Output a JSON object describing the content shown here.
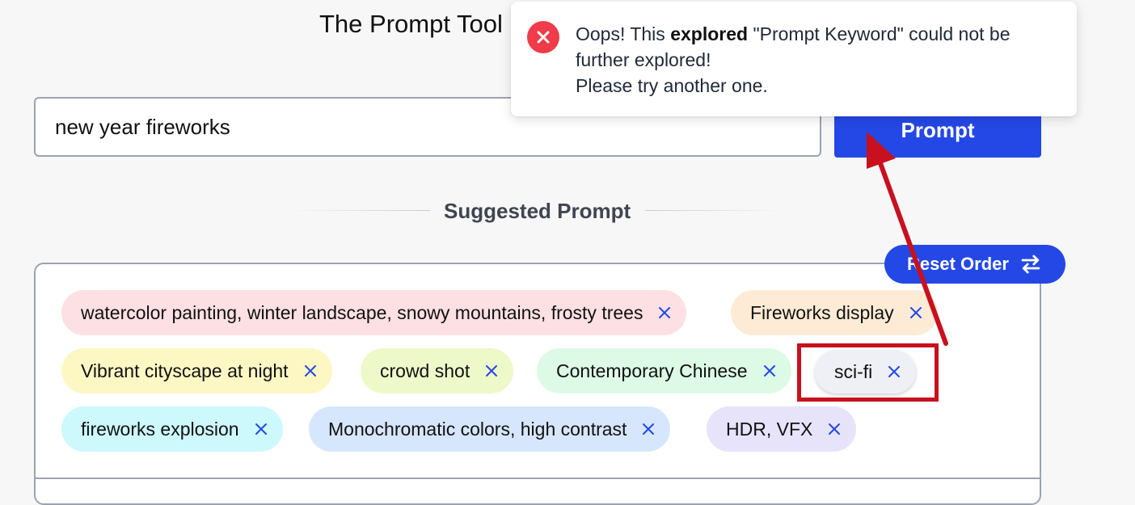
{
  "header": {
    "title": "The Prompt Tool"
  },
  "search": {
    "value": "new year fireworks"
  },
  "prompt_button": {
    "label": "Prompt"
  },
  "suggested": {
    "heading": "Suggested Prompt"
  },
  "reset_button": {
    "label": "Reset Order",
    "icon": "swap-arrows-icon"
  },
  "tags": [
    {
      "label": "watercolor painting, winter landscape, snowy mountains, frosty trees",
      "color": "#fde0e3"
    },
    {
      "label": "Fireworks display",
      "color": "#feebd6"
    },
    {
      "label": "Vibrant cityscape at night",
      "color": "#fdf7c3"
    },
    {
      "label": "crowd shot",
      "color": "#edf9c9"
    },
    {
      "label": "Contemporary Chinese",
      "color": "#dcfae6"
    },
    {
      "label": "sci-fi",
      "color": "#eef0f5"
    },
    {
      "label": "fireworks explosion",
      "color": "#cdf8fc"
    },
    {
      "label": "Monochromatic colors, high contrast",
      "color": "#d6e6fc"
    },
    {
      "label": "HDR, VFX",
      "color": "#e6e3fb"
    }
  ],
  "toast": {
    "icon": "error-x-icon",
    "text_prefix": "Oops! This ",
    "text_bold": "explored",
    "text_suffix": " \"Prompt Keyword\" could not be further explored!",
    "text_line2": "Please try another one."
  },
  "colors": {
    "primary": "#2448e6",
    "error": "#ef3b4a",
    "annotation": "#c8101e",
    "close_icon": "#2448e6"
  }
}
